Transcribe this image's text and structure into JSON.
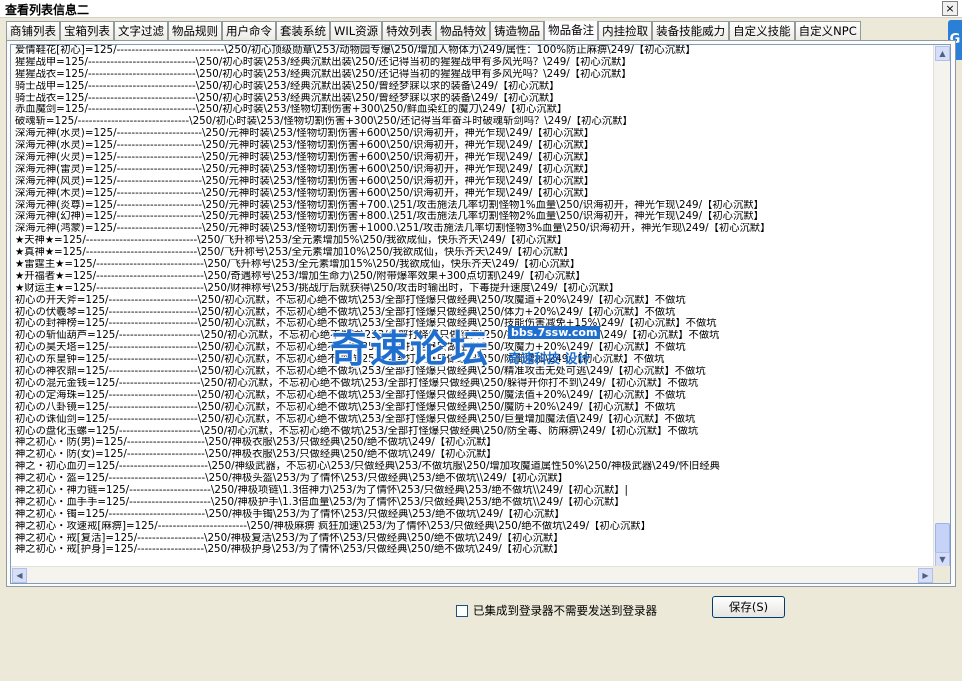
{
  "window": {
    "title": "查看列表信息二",
    "close_label": "×",
    "badge_label": "G"
  },
  "tabs": [
    {
      "label": "商铺列表",
      "active": false
    },
    {
      "label": "宝箱列表",
      "active": false
    },
    {
      "label": "文字过滤",
      "active": false
    },
    {
      "label": "物品规则",
      "active": false
    },
    {
      "label": "用户命令",
      "active": false
    },
    {
      "label": "套装系统",
      "active": false
    },
    {
      "label": "WIL资源",
      "active": false
    },
    {
      "label": "特效列表",
      "active": false
    },
    {
      "label": "物品特效",
      "active": false
    },
    {
      "label": "铸造物品",
      "active": false
    },
    {
      "label": "物品备注",
      "active": true
    },
    {
      "label": "内挂捡取",
      "active": false
    },
    {
      "label": "装备技能威力",
      "active": false
    },
    {
      "label": "自定义技能",
      "active": false
    },
    {
      "label": "自定义NPC",
      "active": false
    }
  ],
  "list_lines": [
    "爱情鞋花[初心]=125/-----------------------------\\250/初心顶级勋章\\253/动物园专爆\\250/增加人物体力\\249/属性：100%防止麻痹\\249/【初心沉默】",
    "猩猩战甲=125/-----------------------------\\250/初心时装\\253/经典沉默出装\\250/还记得当初的猩猩战甲有多风光吗？\\249/【初心沉默】",
    "猩猩战衣=125/-----------------------------\\250/初心时装\\253/经典沉默出装\\250/还记得当初的猩猩战甲有多风光吗？\\249/【初心沉默】",
    "骑士战甲=125/-----------------------------\\250/初心时装\\253/经典沉默出装\\250/曾经梦寐以求的装备\\249/【初心沉默】",
    "骑士战衣=125/-----------------------------\\250/初心时装\\253/经典沉默出装\\250/曾经梦寐以求的装备\\249/【初心沉默】",
    "赤血魔剑=125/-----------------------------\\250/初心时装\\253/怪物切割伤害+300\\250/鲜血染红的魔刀\\249/【初心沉默】",
    "破魂斩=125/------------------------------\\250/初心时装\\253/怪物切割伤害+300\\250/还记得当年奋斗时破魂斩剑吗？\\249/【初心沉默】",
    "深海元神(水灵)=125/-----------------------\\250/元神时装\\253/怪物切割伤害+600\\250/识海初开，神光乍现\\249/【初心沉默】",
    "深海元神(水灵)=125/-----------------------\\250/元神时装\\253/怪物切割伤害+600\\250/识海初开，神光乍现\\249/【初心沉默】",
    "深海元神(火灵)=125/-----------------------\\250/元神时装\\253/怪物切割伤害+600\\250/识海初开，神光乍现\\249/【初心沉默】",
    "深海元神(雷灵)=125/-----------------------\\250/元神时装\\253/怪物切割伤害+600\\250/识海初开，神光乍现\\249/【初心沉默】",
    "深海元神(风灵)=125/-----------------------\\250/元神时装\\253/怪物切割伤害+600\\250/识海初开，神光乍现\\249/【初心沉默】",
    "深海元神(木灵)=125/-----------------------\\250/元神时装\\253/怪物切割伤害+600\\250/识海初开，神光乍现\\249/【初心沉默】",
    "深海元神(炎尊)=125/-----------------------\\250/元神时装\\253/怪物切割伤害+700.\\251/攻击施法几率切割怪物1%血量\\250/识海初开，神光乍现\\249/【初心沉默】",
    "深海元神(幻神)=125/-----------------------\\250/元神时装\\253/怪物切割伤害+800.\\251/攻击施法几率切割怪物2%血量\\250/识海初开，神光乍现\\249/【初心沉默】",
    "深海元神(鸿蒙)=125/-----------------------\\250/元神时装\\253/怪物切割伤害+1000.\\251/攻击施法几率切割怪物3%血量\\250/识海初开，神光乍现\\249/【初心沉默】",
    "★天神★=125/------------------------------\\250/飞升称号\\253/全元素增加5%\\250/我欲成仙，快乐齐天\\249/【初心沉默】",
    "★真神★=125/------------------------------\\250/飞升称号\\253/全元素增加10%\\250/我欲成仙，快乐齐天\\249/【初心沉默】",
    "★雷霆主★=125/-----------------------------\\250/飞升称号\\253/全元素增加15%\\250/我欲成仙，快乐齐天\\249/【初心沉默】",
    "★开福者★=125/-----------------------------\\250/奇遇称号\\253/增加生命力\\250/附带爆率效果+300点切割\\249/【初心沉默】",
    "★财运主★=125/-----------------------------\\250/财神称号\\253/挑战厅后就获得\\250/攻击时输出时，下毒提升速度\\249/【初心沉默】",
    "初心の开天斧=125/------------------------\\250/初心沉默，不忘初心绝不做坑\\253/全部打怪爆只做经典\\250/攻魔道+20%\\249/【初心沉默】不做坑",
    "初心の伏羲琴=125/------------------------\\250/初心沉默，不忘初心绝不做坑\\253/全部打怪爆只做经典\\250/体力+20%\\249/【初心沉默】不做坑",
    "初心の封神榜=125/------------------------\\250/初心沉默，不忘初心绝不做坑\\253/全部打怪爆只做经典\\250/技能伤害减免+15%\\249/【初心沉默】不做坑",
    "初心の斩仙葫芦=125/----------------------\\250/初心沉默，不忘初心绝不做坑\\253/全部打怪爆只做经典\\250/技能伤害增加+15%\\249/【初心沉默】不做坑",
    "初心の昊天塔=125/------------------------\\250/初心沉默，不忘初心绝不做坑\\253/全部打怪爆只做经典\\250/攻魔力+20%\\249/【初心沉默】不做坑",
    "初心の东皇钟=125/------------------------\\250/初心沉默，不忘初心绝不做坑\\253/全部打怪爆只做经典\\250/防御增加\\249/【初心沉默】不做坑",
    "初心の神农鼎=125/------------------------\\250/初心沉默，不忘初心绝不做坑\\253/全部打怪爆只做经典\\250/精准攻击无处可逃\\249/【初心沉默】不做坑",
    "初心の混元金钱=125/----------------------\\250/初心沉默，不忘初心绝不做坑\\253/全部打怪爆只做经典\\250/躲得开你打不到\\249/【初心沉默】不做坑",
    "初心の定海珠=125/------------------------\\250/初心沉默，不忘初心绝不做坑\\253/全部打怪爆只做经典\\250/魔法值+20%\\249/【初心沉默】不做坑",
    "初心の八卦镜=125/------------------------\\250/初心沉默，不忘初心绝不做坑\\253/全部打怪爆只做经典\\250/魔防+20%\\249/【初心沉默】不做坑",
    "初心の诛仙剑=125/------------------------\\250/初心沉默，不忘初心绝不做坑\\253/全部打怪爆只做经典\\250/巨量增加魔法值\\249/【初心沉默】不做坑",
    "初心の盘化玉螺=125/----------------------\\250/初心沉默，不忘初心绝不做坑\\253/全部打怪爆只做经典\\250/防全毒、防麻痹\\249/【初心沉默】不做坑",
    "神之初心・防(男)=125/---------------------\\250/神极衣服\\253/只做经典\\250/绝不做坑\\249/【初心沉默】",
    "神之初心・防(女)=125/---------------------\\250/神极衣服\\253/只做经典\\250/绝不做坑\\249/【初心沉默】",
    "神之・初心血刃=125/------------------------\\250/神级武器，不忘初心\\253/只做经典\\253/不做坑服\\250/增加攻魔道属性50%\\250/神极武器\\249/怀旧经典",
    "神之初心・盔=125/--------------------------\\250/神极头盔\\253/为了情怀\\253/只做经典\\253/绝不做坑\\\\249/【初心沉默】",
    "神之初心・神力链=125/----------------------\\250/神极项链\\1.3倍神力\\253/为了情怀\\253/只做经典\\253/绝不做坑\\\\249/【初心沉默】|",
    "神之初心・血手手=125/----------------------\\250/神极护手\\1.3倍血量\\253/为了情怀\\253/只做经典\\253/绝不做坑\\\\249/【初心沉默】",
    "神之初心・镯=125/--------------------------\\250/神极手镯\\253/为了情怀\\253/只做经典\\253/绝不做坑\\249/【初心沉默】",
    "神之初心・攻速戒[麻痹]=125/------------------------\\250/神极麻痹 疯狂加速\\253/为了情怀\\253/只做经典\\250/绝不做坑\\249/【初心沉默】",
    "神之初心・戒[复活]=125/------------------\\250/神极复活\\253/为了情怀\\253/只做经典\\250/绝不做坑\\249/【初心沉默】",
    "神之初心・戒[护身]=125/------------------\\250/神极护身\\253/为了情怀\\253/只做经典\\250/绝不做坑\\249/【初心沉默】"
  ],
  "watermark": {
    "main": "奇速论坛",
    "tag": "bbs.7ssw.com",
    "sub": "奇速科技 设计"
  },
  "footer": {
    "checkbox_label": "已集成到登录器不需要发送到登录器",
    "checkbox_checked": false,
    "save_label": "保存(S)"
  }
}
